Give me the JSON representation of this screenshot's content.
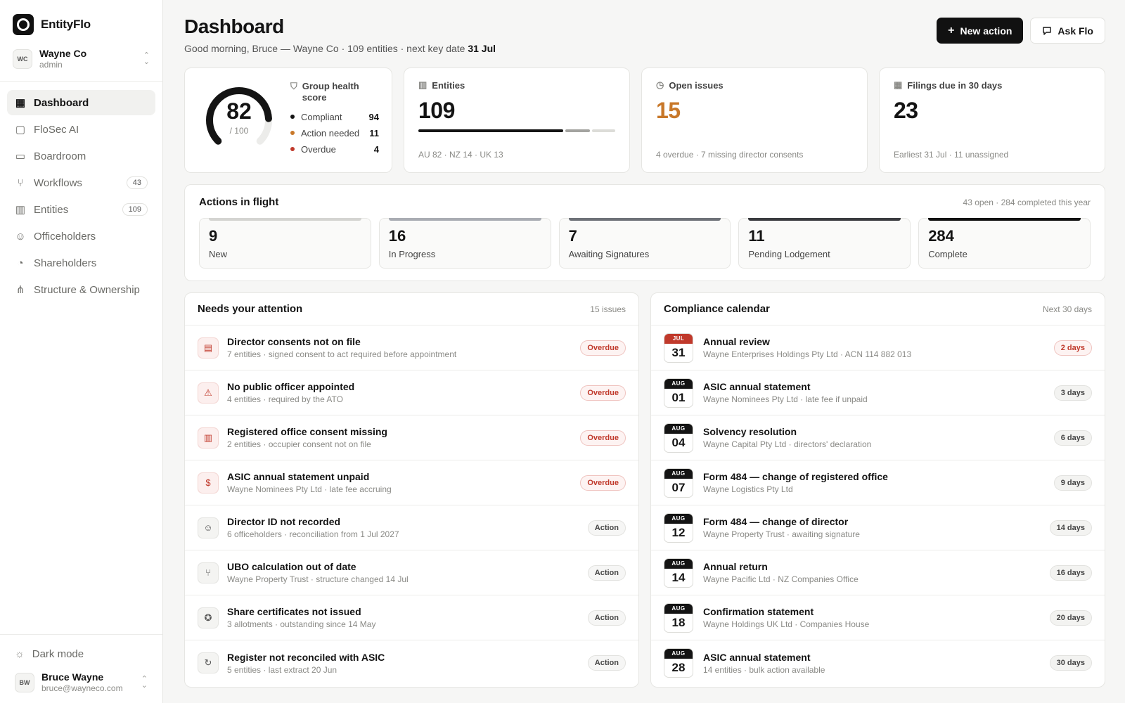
{
  "brand": {
    "name": "EntityFlo"
  },
  "org": {
    "badge": "WC",
    "name": "Wayne Co",
    "role": "admin"
  },
  "nav": [
    {
      "label": "Dashboard",
      "icon": "grid-icon",
      "count": ""
    },
    {
      "label": "FloSec AI",
      "icon": "chat-icon",
      "count": ""
    },
    {
      "label": "Boardroom",
      "icon": "monitor-icon",
      "count": ""
    },
    {
      "label": "Workflows",
      "icon": "workflow-icon",
      "count": "43"
    },
    {
      "label": "Entities",
      "icon": "building-icon",
      "count": "109"
    },
    {
      "label": "Officeholders",
      "icon": "person-icon",
      "count": ""
    },
    {
      "label": "Shareholders",
      "icon": "pie-icon",
      "count": ""
    },
    {
      "label": "Structure & Ownership",
      "icon": "hierarchy-icon",
      "count": ""
    }
  ],
  "footer": {
    "dark_mode": "Dark mode",
    "user_badge": "BW",
    "user_name": "Bruce Wayne",
    "user_email": "bruce@wayneco.com"
  },
  "header": {
    "title": "Dashboard",
    "greeting": "Good morning, Bruce — Wayne Co · 109 entities · next key date ",
    "key_date": "31 Jul",
    "new_action": "New action",
    "ask": "Ask Flo"
  },
  "health": {
    "score": "82",
    "out_of": "/ 100",
    "score_fraction": 0.82,
    "title": "Group health score",
    "items": [
      {
        "label": "Compliant",
        "value": "94",
        "color": "#141414"
      },
      {
        "label": "Action needed",
        "value": "11",
        "color": "#c8782a"
      },
      {
        "label": "Overdue",
        "value": "4",
        "color": "#c0392b"
      }
    ]
  },
  "entities": {
    "label": "Entities",
    "value": "109",
    "foot": "AU 82 · NZ 14 · UK 13",
    "split": [
      {
        "value": 82,
        "color": "#141414"
      },
      {
        "value": 14,
        "color": "#a3a3a0"
      },
      {
        "value": 13,
        "color": "#dcdcd8"
      }
    ]
  },
  "issues": {
    "label": "Open issues",
    "value": "15",
    "color": "#c8782a",
    "foot": "4 overdue · 7 missing director consents"
  },
  "filings": {
    "label": "Filings due in 30 days",
    "value": "23",
    "foot": "Earliest 31 Jul · 11 unassigned"
  },
  "aif": {
    "title": "Actions in flight",
    "meta": "43 open · 284 completed this year",
    "stages": [
      {
        "value": "9",
        "label": "New",
        "color": "#d4d4d1"
      },
      {
        "value": "16",
        "label": "In Progress",
        "color": "#a9acb3"
      },
      {
        "value": "7",
        "label": "Awaiting Signatures",
        "color": "#6e7178"
      },
      {
        "value": "11",
        "label": "Pending Lodgement",
        "color": "#3a3b3f"
      },
      {
        "value": "284",
        "label": "Complete",
        "color": "#111111"
      }
    ]
  },
  "attention": {
    "title": "Needs your attention",
    "meta": "15 issues",
    "rows": [
      {
        "title": "Director consents not on file",
        "sub": "7 entities · signed consent to act required before appointment",
        "status": "Overdue",
        "icon": "file-alert-icon",
        "glyph": "▤"
      },
      {
        "title": "No public officer appointed",
        "sub": "4 entities · required by the ATO",
        "status": "Overdue",
        "icon": "warning-icon",
        "glyph": "⚠"
      },
      {
        "title": "Registered office consent missing",
        "sub": "2 entities · occupier consent not on file",
        "status": "Overdue",
        "icon": "building-icon",
        "glyph": "▥"
      },
      {
        "title": "ASIC annual statement unpaid",
        "sub": "Wayne Nominees Pty Ltd · late fee accruing",
        "status": "Overdue",
        "icon": "dollar-icon",
        "glyph": "$"
      },
      {
        "title": "Director ID not recorded",
        "sub": "6 officeholders · reconciliation from 1 Jul 2027",
        "status": "Action",
        "icon": "person-icon",
        "glyph": "☺"
      },
      {
        "title": "UBO calculation out of date",
        "sub": "Wayne Property Trust · structure changed 14 Jul",
        "status": "Action",
        "icon": "hierarchy-icon",
        "glyph": "⑂"
      },
      {
        "title": "Share certificates not issued",
        "sub": "3 allotments · outstanding since 14 May",
        "status": "Action",
        "icon": "award-icon",
        "glyph": "✪"
      },
      {
        "title": "Register not reconciled with ASIC",
        "sub": "5 entities · last extract 20 Jun",
        "status": "Action",
        "icon": "refresh-icon",
        "glyph": "↻"
      }
    ]
  },
  "calendar": {
    "title": "Compliance calendar",
    "meta": "Next 30 days",
    "rows": [
      {
        "mon": "JUL",
        "day": "31",
        "title": "Annual review",
        "sub": "Wayne Enterprises Holdings Pty Ltd · ACN 114 882 013",
        "due": "2 days",
        "urgent": true
      },
      {
        "mon": "AUG",
        "day": "01",
        "title": "ASIC annual statement",
        "sub": "Wayne Nominees Pty Ltd · late fee if unpaid",
        "due": "3 days",
        "urgent": false
      },
      {
        "mon": "AUG",
        "day": "04",
        "title": "Solvency resolution",
        "sub": "Wayne Capital Pty Ltd · directors' declaration",
        "due": "6 days",
        "urgent": false
      },
      {
        "mon": "AUG",
        "day": "07",
        "title": "Form 484 — change of registered office",
        "sub": "Wayne Logistics Pty Ltd",
        "due": "9 days",
        "urgent": false
      },
      {
        "mon": "AUG",
        "day": "12",
        "title": "Form 484 — change of director",
        "sub": "Wayne Property Trust · awaiting signature",
        "due": "14 days",
        "urgent": false
      },
      {
        "mon": "AUG",
        "day": "14",
        "title": "Annual return",
        "sub": "Wayne Pacific Ltd · NZ Companies Office",
        "due": "16 days",
        "urgent": false
      },
      {
        "mon": "AUG",
        "day": "18",
        "title": "Confirmation statement",
        "sub": "Wayne Holdings UK Ltd · Companies House",
        "due": "20 days",
        "urgent": false
      },
      {
        "mon": "AUG",
        "day": "28",
        "title": "ASIC annual statement",
        "sub": "14 entities · bulk action available",
        "due": "30 days",
        "urgent": false
      }
    ]
  }
}
